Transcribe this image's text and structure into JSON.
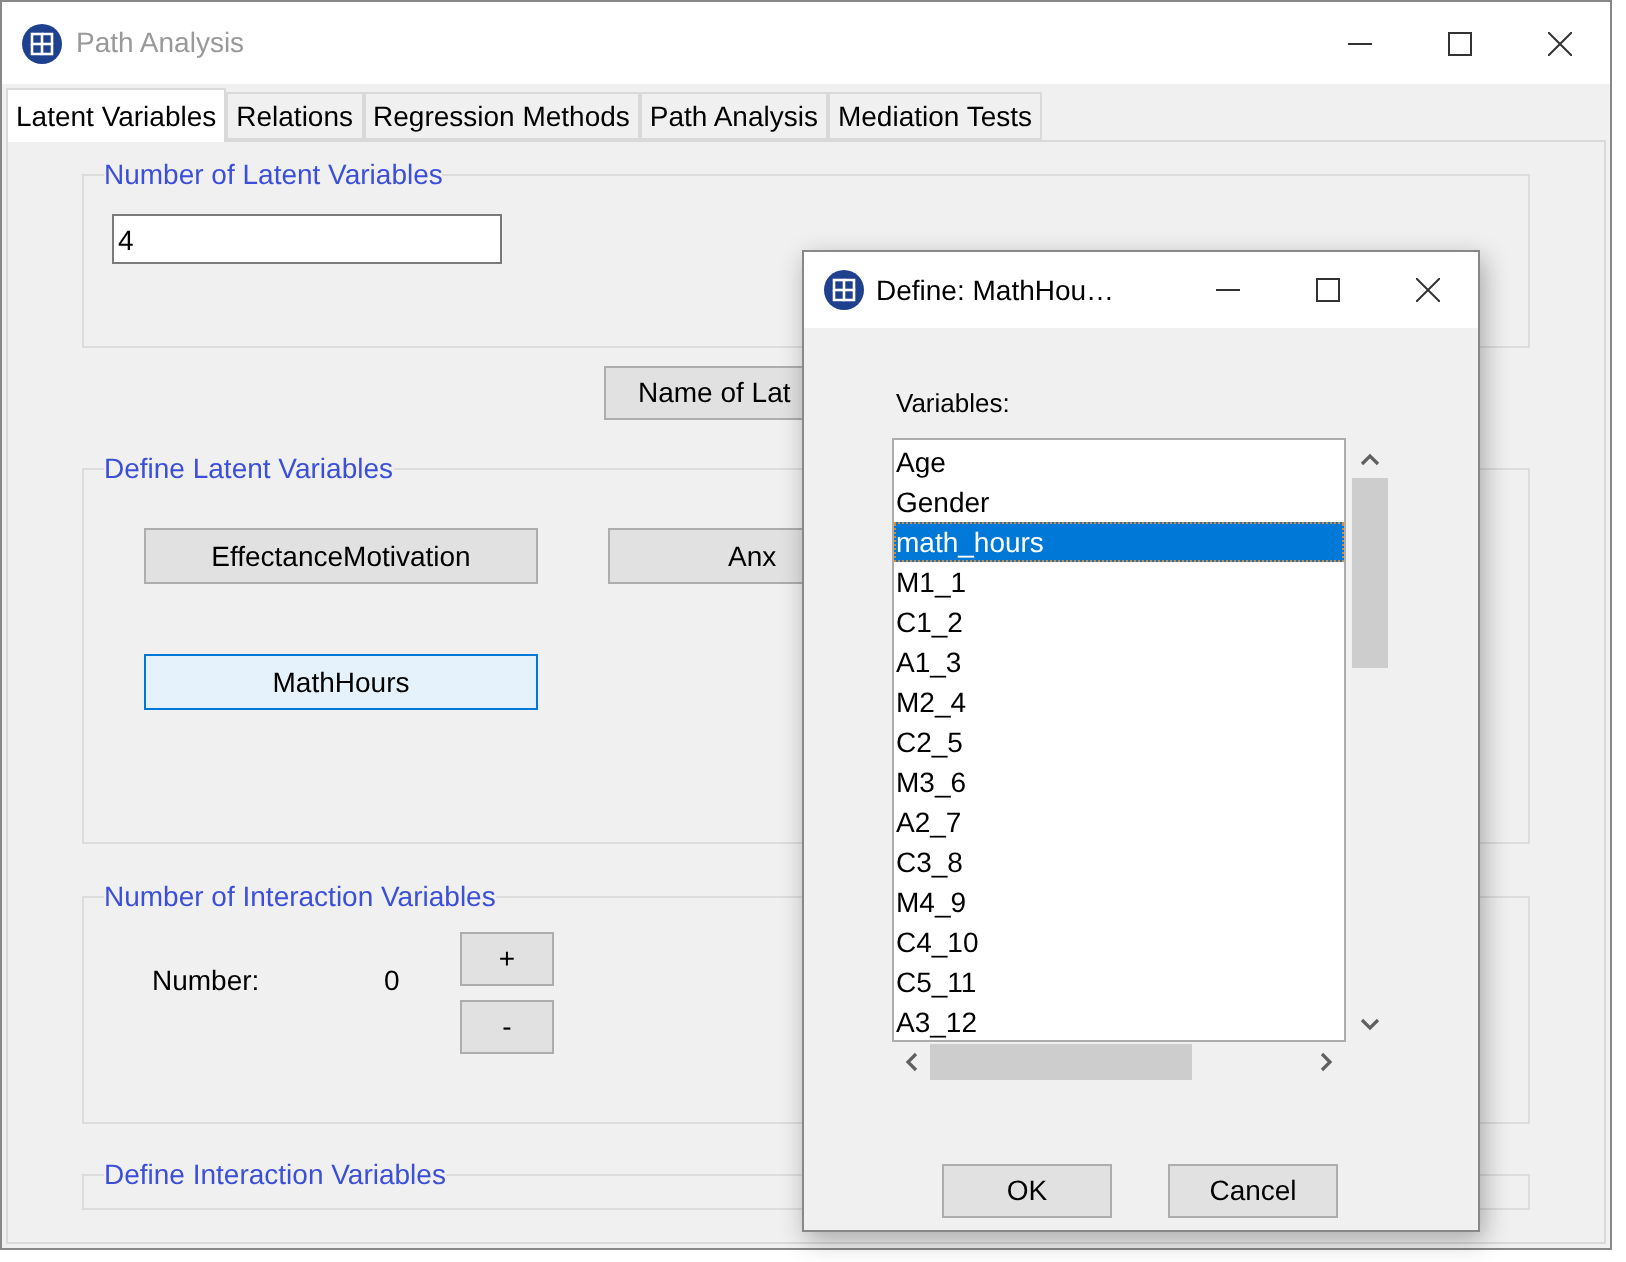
{
  "window": {
    "title": "Path Analysis"
  },
  "tabs": [
    {
      "label": "Latent Variables",
      "selected": true
    },
    {
      "label": "Relations",
      "selected": false
    },
    {
      "label": "Regression Methods",
      "selected": false
    },
    {
      "label": "Path Analysis",
      "selected": false
    },
    {
      "label": "Mediation Tests",
      "selected": false
    }
  ],
  "latent_count": {
    "title": "Number of Latent Variables",
    "value": "4"
  },
  "name_button": "Name of Lat",
  "define_latent": {
    "title": "Define Latent Variables",
    "buttons": [
      {
        "label": "EffectanceMotivation",
        "selected": false
      },
      {
        "label": "Anx",
        "selected": false
      },
      {
        "label": "MathHours",
        "selected": true
      }
    ]
  },
  "interaction_count": {
    "title": "Number of Interaction Variables",
    "label": "Number:",
    "value": "0",
    "buttons": [
      "+",
      "-"
    ]
  },
  "define_interaction": {
    "title": "Define Interaction Variables"
  },
  "dialog": {
    "title": "Define: MathHou…",
    "list_label": "Variables:",
    "items": [
      {
        "label": "Age",
        "selected": false
      },
      {
        "label": "Gender",
        "selected": false
      },
      {
        "label": "math_hours",
        "selected": true
      },
      {
        "label": "M1_1",
        "selected": false
      },
      {
        "label": "C1_2",
        "selected": false
      },
      {
        "label": "A1_3",
        "selected": false
      },
      {
        "label": "M2_4",
        "selected": false
      },
      {
        "label": "C2_5",
        "selected": false
      },
      {
        "label": "M3_6",
        "selected": false
      },
      {
        "label": "A2_7",
        "selected": false
      },
      {
        "label": "C3_8",
        "selected": false
      },
      {
        "label": "M4_9",
        "selected": false
      },
      {
        "label": "C4_10",
        "selected": false
      },
      {
        "label": "C5_11",
        "selected": false
      },
      {
        "label": "A3_12",
        "selected": false
      }
    ],
    "buttons": [
      "OK",
      "Cancel"
    ]
  }
}
